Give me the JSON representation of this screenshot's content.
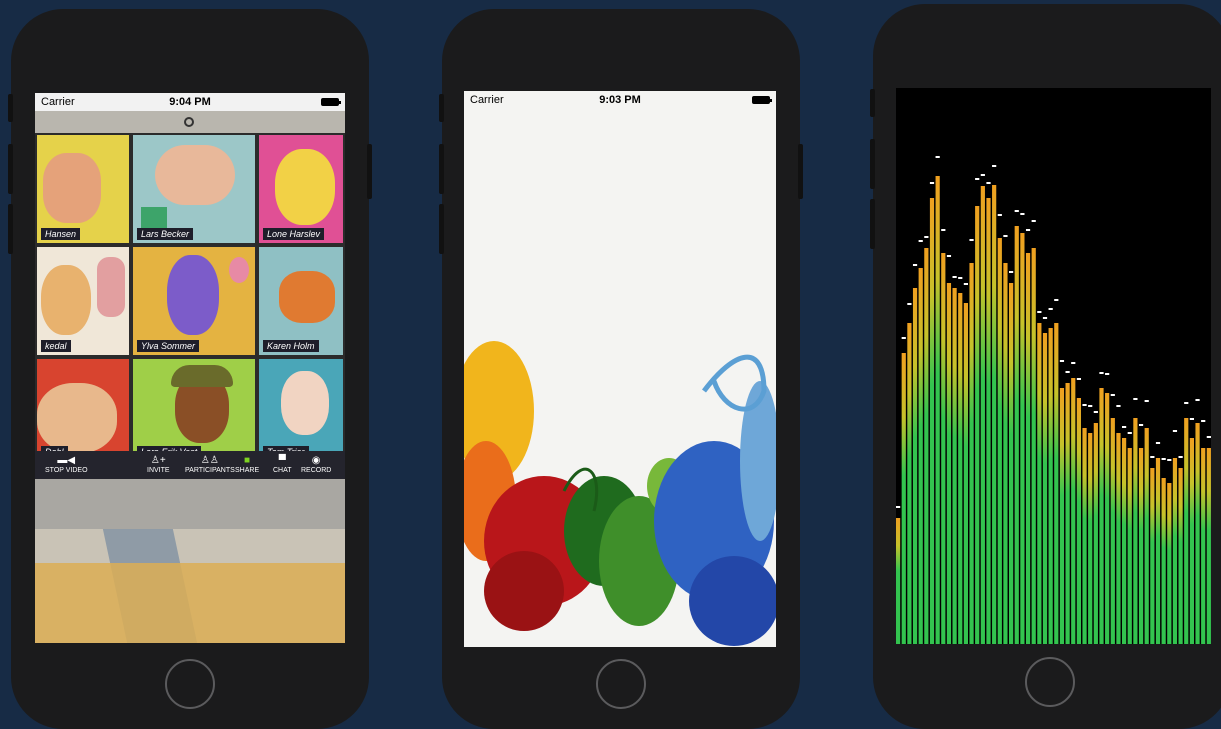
{
  "phones": [
    {
      "status": {
        "carrier": "Carrier",
        "time": "9:04 PM"
      },
      "zoom_grid": {
        "names": [
          "Hansen",
          "Lars Becker",
          "Lone Harslev",
          "kedal",
          "Ylva Sommer",
          "Karen Holm",
          "Dahl",
          "Lars-Erik Vest",
          "Tom Trier"
        ]
      },
      "toolbar": [
        "STOP VIDEO",
        "INVITE",
        "PARTICIPANTS",
        "SHARE",
        "CHAT",
        "RECORD"
      ]
    },
    {
      "status": {
        "carrier": "Carrier",
        "time": "9:03 PM"
      }
    },
    {
      "visualizer": {
        "bar_color": "#33c44f",
        "peak_color": "#ffffff"
      }
    }
  ]
}
